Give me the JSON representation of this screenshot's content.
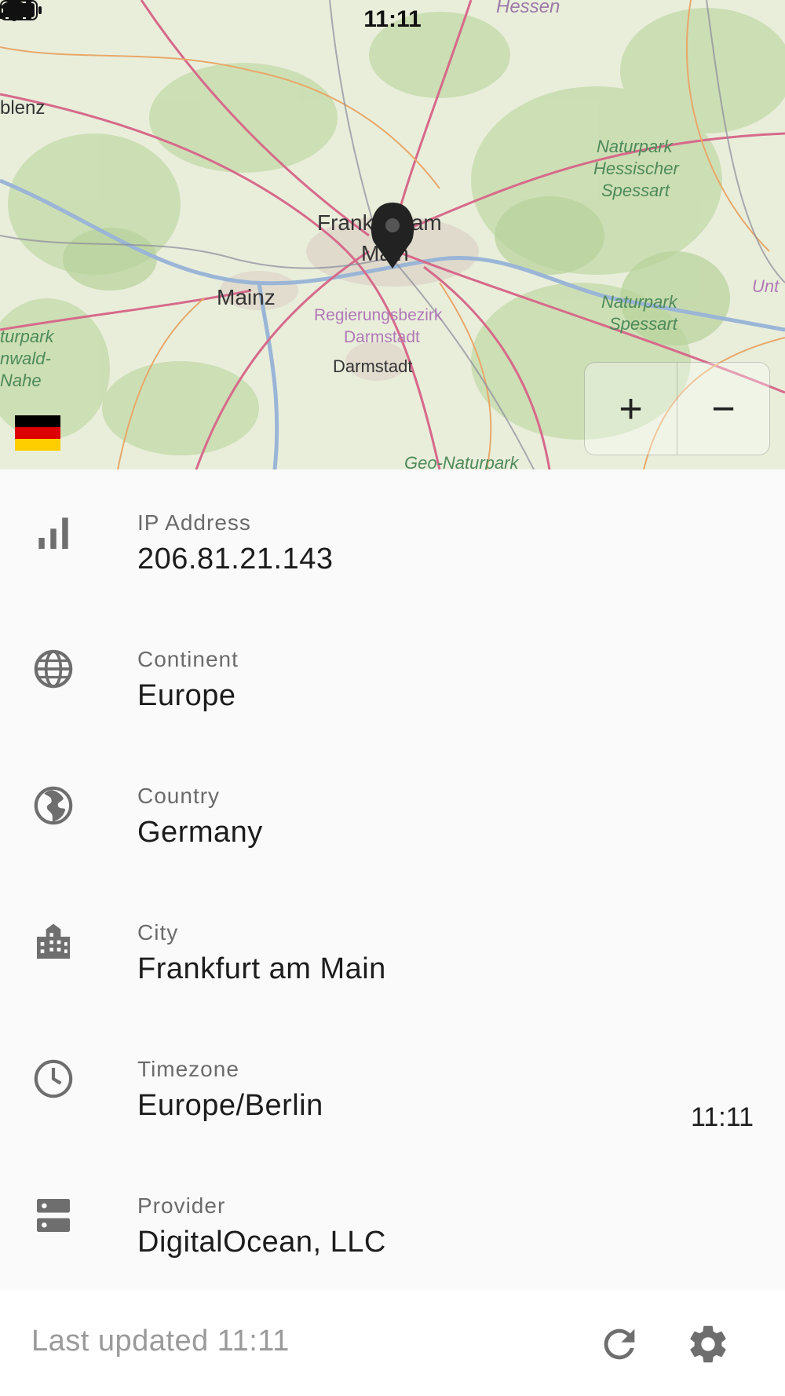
{
  "status_bar": {
    "time": "11:11"
  },
  "map": {
    "labels": {
      "hessen": "Hessen",
      "koblenz": "blenz",
      "np_hessischer_1": "Naturpark",
      "np_hessischer_2": "Hessischer",
      "np_hessischer_3": "Spessart",
      "frankfurt_1": "Frankfurt am",
      "frankfurt_2": "Main",
      "mainz": "Mainz",
      "regbez_1": "Regierungsbezirk",
      "regbez_2": "Darmstadt",
      "darmstadt": "Darmstadt",
      "np_spessart_1": "Naturpark",
      "np_spessart_2": "Spessart",
      "np_left_1": "turpark",
      "np_left_2": "nwald-",
      "np_left_3": "Nahe",
      "geo": "Geo-Naturpark",
      "unt": "Unt"
    },
    "zoom_in": "+",
    "zoom_out": "−",
    "flag_colors": [
      "#000000",
      "#dd0000",
      "#ffce00"
    ]
  },
  "details": [
    {
      "icon": "signal-bars-icon",
      "label": "IP Address",
      "value": "206.81.21.143",
      "trailing": ""
    },
    {
      "icon": "globe-icon",
      "label": "Continent",
      "value": "Europe",
      "trailing": ""
    },
    {
      "icon": "globe-americas-icon",
      "label": "Country",
      "value": "Germany",
      "trailing": ""
    },
    {
      "icon": "city-icon",
      "label": "City",
      "value": "Frankfurt am Main",
      "trailing": ""
    },
    {
      "icon": "clock-icon",
      "label": "Timezone",
      "value": "Europe/Berlin",
      "trailing": "11:11"
    },
    {
      "icon": "server-icon",
      "label": "Provider",
      "value": "DigitalOcean, LLC",
      "trailing": ""
    }
  ],
  "footer": {
    "last_updated": "Last updated 11:11"
  },
  "colors": {
    "icon": "#6e6e6e",
    "map_bg": "#e9eedb",
    "road": "#d66a8a",
    "river": "#9ab5d6",
    "forest": "#c9dcb0"
  }
}
